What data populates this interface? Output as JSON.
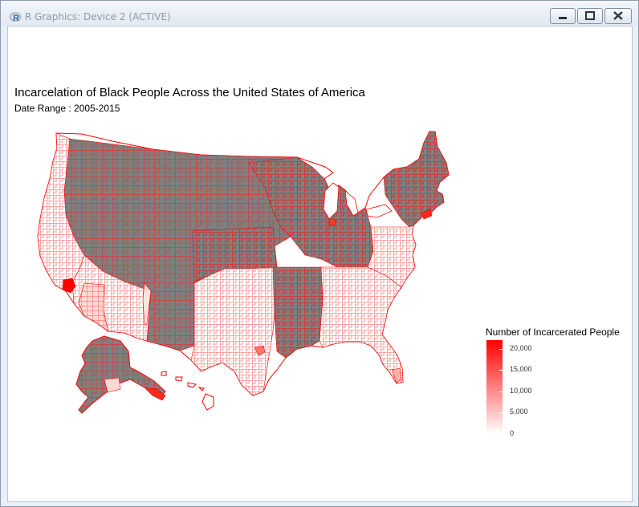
{
  "window": {
    "title": "R Graphics: Device 2 (ACTIVE)",
    "icon": "r-logo-icon",
    "controls": [
      "minimize-icon",
      "restore-icon",
      "close-icon"
    ]
  },
  "plot": {
    "title": "Incarcelation of Black People Across the United States of America",
    "subtitle": "Date Range : 2005-2015"
  },
  "legend": {
    "title": "Number of Incarcerated People",
    "ticks": [
      {
        "value": 20000,
        "label": "20,000"
      },
      {
        "value": 15000,
        "label": "15,000"
      },
      {
        "value": 10000,
        "label": "10,000"
      },
      {
        "value": 5000,
        "label": "5,000"
      },
      {
        "value": 0,
        "label": "0"
      }
    ],
    "min": 0,
    "max": 22000,
    "low_color": "#ffffff",
    "high_color": "#ff0000"
  },
  "map": {
    "na_color": "#7f7f7f",
    "border_color": "#ff0000"
  }
}
